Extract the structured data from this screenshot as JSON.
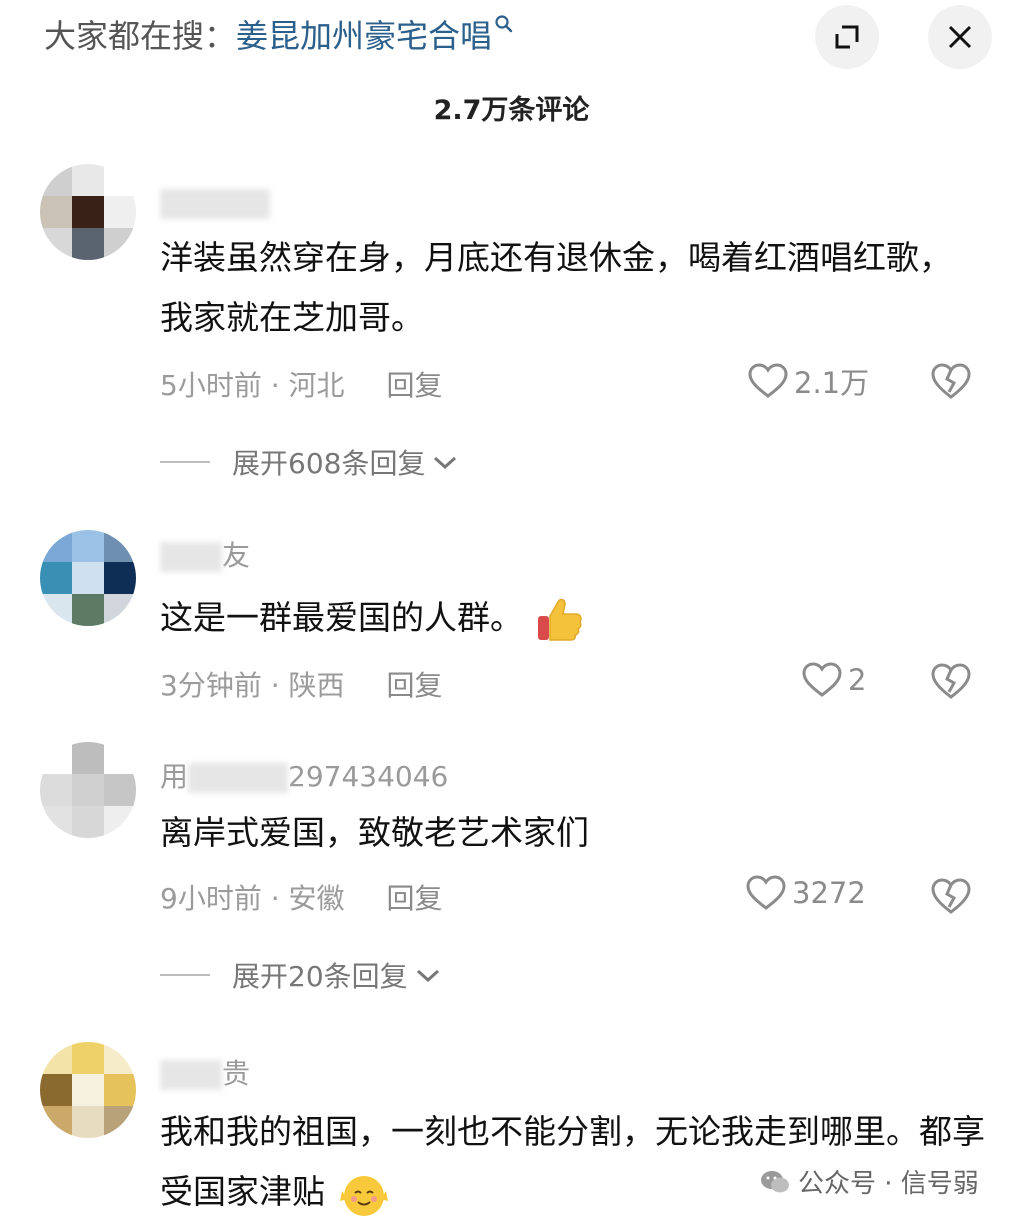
{
  "header": {
    "search_prefix": "大家都在搜：",
    "search_term": "姜昆加州豪宅合唱",
    "comment_count": "2.7万条评论"
  },
  "comments": [
    {
      "user_suffix": "",
      "text": "洋装虽然穿在身，月底还有退休金，喝着红酒唱红歌，我家就在芝加哥。",
      "time": "5小时前",
      "location": "河北",
      "reply": "回复",
      "likes": "2.1万",
      "expand": "展开608条回复"
    },
    {
      "user_suffix": "友",
      "text": "这是一群最爱国的人群。",
      "time": "3分钟前",
      "location": "陕西",
      "reply": "回复",
      "likes": "2"
    },
    {
      "user_prefix": "用",
      "user_suffix": "297434046",
      "text": "离岸式爱国，致敬老艺术家们",
      "time": "9小时前",
      "location": "安徽",
      "reply": "回复",
      "likes": "3272",
      "expand": "展开20条回复"
    },
    {
      "user_suffix": "贵",
      "text": "我和我的祖国，一刻也不能分割，无论我走到哪里。都享受国家津贴",
      "time": "",
      "location": ""
    }
  ],
  "watermark": "公众号 · 信号弱",
  "icons": {
    "search": "search-icon",
    "minimize": "minimize-icon",
    "close": "close-icon",
    "like": "heart-icon",
    "dislike": "broken-heart-icon",
    "expand": "chevron-down-icon"
  },
  "colors": {
    "search_term": "#2b5f8c",
    "meta": "#9b9b9b",
    "background": "#ffffff"
  }
}
